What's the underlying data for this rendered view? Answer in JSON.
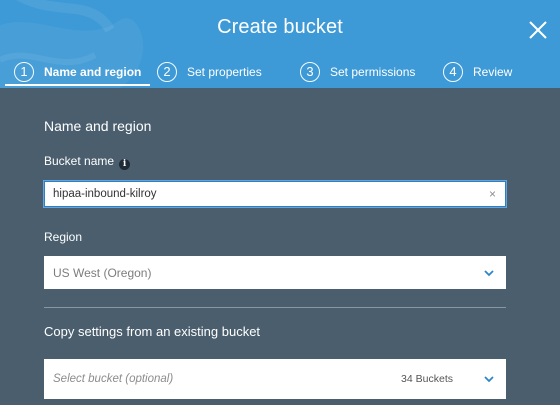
{
  "header": {
    "title": "Create bucket"
  },
  "steps": [
    {
      "number": "1",
      "label": "Name and region",
      "active": true
    },
    {
      "number": "2",
      "label": "Set properties",
      "active": false
    },
    {
      "number": "3",
      "label": "Set permissions",
      "active": false
    },
    {
      "number": "4",
      "label": "Review",
      "active": false
    }
  ],
  "form": {
    "section_title": "Name and region",
    "bucket_name_label": "Bucket name",
    "bucket_name_value": "hipaa-inbound-kilroy",
    "clear_glyph": "×",
    "region_label": "Region",
    "region_value": "US West (Oregon)",
    "copy_title": "Copy settings from an existing bucket",
    "copy_placeholder": "Select bucket (optional)",
    "bucket_count": "34 Buckets"
  },
  "colors": {
    "header_bg": "#3d9ad6",
    "body_bg": "#4a5e6e",
    "focus_border": "#2f7fbf",
    "chevron": "#2e86c8"
  },
  "icons": {
    "close": "close-icon",
    "info": "info-icon",
    "chevron": "chevron-down-icon"
  }
}
